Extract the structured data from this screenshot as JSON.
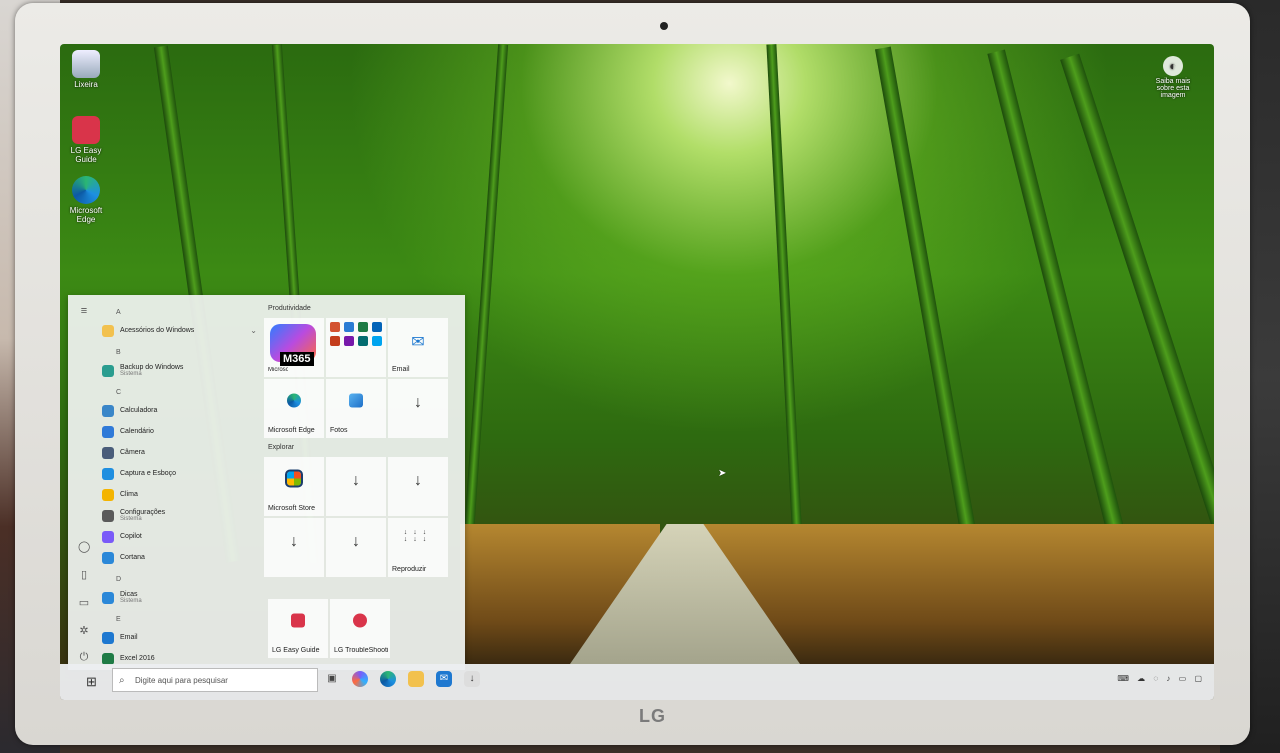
{
  "desktop": {
    "icons": [
      {
        "label": "Lixeira",
        "icon": "recycle-bin-icon"
      },
      {
        "label": "LG Easy Guide",
        "icon": "lg-easy-guide-icon"
      },
      {
        "label": "Microsoft Edge",
        "icon": "edge-icon"
      }
    ],
    "learn_more": "Saiba mais sobre esta imagem"
  },
  "start_menu": {
    "app_list": [
      {
        "type": "letter",
        "text": "A"
      },
      {
        "type": "app",
        "label": "Acessórios do Windows",
        "icon": "folder-icon",
        "color": "#f2c14e",
        "expand": "⌄"
      },
      {
        "type": "letter",
        "text": "B"
      },
      {
        "type": "app",
        "label": "Backup do Windows",
        "sub": "Sistema",
        "icon": "cloud-icon",
        "color": "#2a9d8f"
      },
      {
        "type": "letter",
        "text": "C"
      },
      {
        "type": "app",
        "label": "Calculadora",
        "icon": "calculator-icon",
        "color": "#3a86c8"
      },
      {
        "type": "app",
        "label": "Calendário",
        "icon": "calendar-icon",
        "color": "#2f7ad8"
      },
      {
        "type": "app",
        "label": "Câmera",
        "icon": "camera-icon",
        "color": "#4a5d7a"
      },
      {
        "type": "app",
        "label": "Captura e Esboço",
        "icon": "snip-icon",
        "color": "#1f8fe0"
      },
      {
        "type": "app",
        "label": "Clima",
        "icon": "weather-icon",
        "color": "#f4b400"
      },
      {
        "type": "app",
        "label": "Configurações",
        "sub": "Sistema",
        "icon": "gear-icon",
        "color": "#5a5a5a"
      },
      {
        "type": "app",
        "label": "Copilot",
        "icon": "copilot-icon",
        "color": "#7a5af8"
      },
      {
        "type": "app",
        "label": "Cortana",
        "icon": "cortana-icon",
        "color": "#2b88d8"
      },
      {
        "type": "letter",
        "text": "D"
      },
      {
        "type": "app",
        "label": "Dicas",
        "sub": "Sistema",
        "icon": "tips-icon",
        "color": "#2b88d8"
      },
      {
        "type": "letter",
        "text": "E"
      },
      {
        "type": "app",
        "label": "Email",
        "icon": "mail-icon",
        "color": "#1e78d0"
      },
      {
        "type": "app",
        "label": "Excel 2016",
        "icon": "excel-icon",
        "color": "#1e7b45"
      }
    ],
    "productivity": {
      "title": "Produtividade",
      "m365_label": "Microsoft 365",
      "m365_tag": "M365",
      "email_label": "Email",
      "edge_label": "Microsoft Edge",
      "photos_label": "Fotos",
      "office_colors": [
        "#d35230",
        "#2b7cd3",
        "#1e7b45",
        "#0364b8",
        "#c43e1c",
        "#7719aa",
        "#036c70",
        "#00a4ef"
      ]
    },
    "explore": {
      "title": "Explorar",
      "store_label": "Microsoft Store",
      "play_label": "Reproduzir"
    },
    "lg_tiles": [
      {
        "label": "LG Easy Guide",
        "color": "#d9344a"
      },
      {
        "label": "LG TroubleShooti...",
        "color": "#d9344a"
      }
    ]
  },
  "taskbar": {
    "search_placeholder": "Digite aqui para pesquisar",
    "pinned": [
      "task-view-icon",
      "copilot-icon",
      "edge-icon",
      "file-explorer-icon",
      "mail-icon",
      "download-icon"
    ],
    "brand": "LG"
  }
}
